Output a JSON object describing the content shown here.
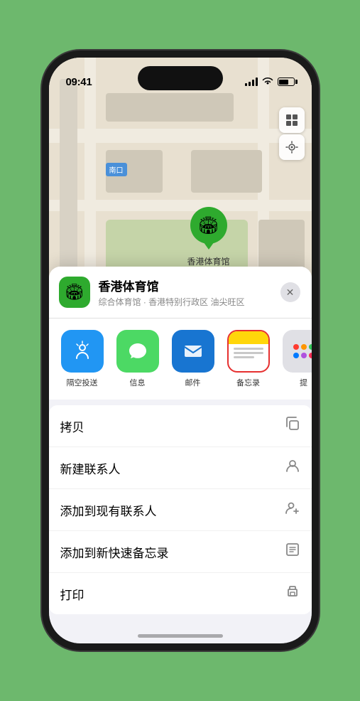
{
  "status_bar": {
    "time": "09:41",
    "location_arrow": "▲"
  },
  "map": {
    "label": "南口",
    "pin_label": "香港体育馆",
    "controls": {
      "map_icon": "🗺",
      "location_icon": "↖"
    }
  },
  "venue_card": {
    "name": "香港体育馆",
    "subtitle": "综合体育馆 · 香港特别行政区 油尖旺区",
    "close_label": "✕"
  },
  "share_items": [
    {
      "id": "airdrop",
      "label": "隔空投送",
      "type": "airdrop"
    },
    {
      "id": "message",
      "label": "信息",
      "type": "message"
    },
    {
      "id": "mail",
      "label": "邮件",
      "type": "mail"
    },
    {
      "id": "notes",
      "label": "备忘录",
      "type": "notes"
    },
    {
      "id": "more",
      "label": "提",
      "type": "more"
    }
  ],
  "action_items": [
    {
      "id": "copy",
      "label": "拷贝",
      "icon": "⧉"
    },
    {
      "id": "new-contact",
      "label": "新建联系人",
      "icon": "👤"
    },
    {
      "id": "add-existing",
      "label": "添加到现有联系人",
      "icon": "👤+"
    },
    {
      "id": "add-notes",
      "label": "添加到新快速备忘录",
      "icon": "▤"
    },
    {
      "id": "print",
      "label": "打印",
      "icon": "🖨"
    }
  ]
}
